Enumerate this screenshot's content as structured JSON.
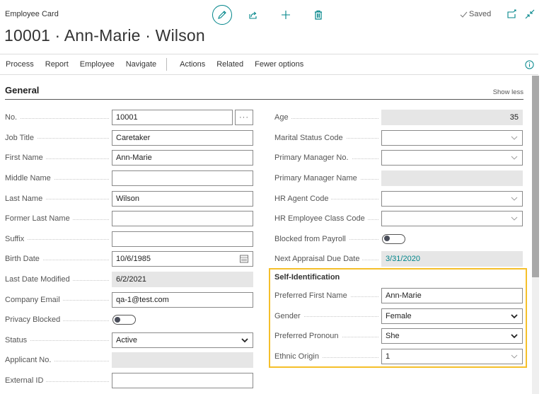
{
  "header": {
    "caption": "Employee Card",
    "title": "10001 · Ann-Marie · Wilson",
    "saved_status": "Saved",
    "icons": [
      "edit-icon",
      "share-icon",
      "add-icon",
      "delete-icon",
      "open-new-window-icon",
      "collapse-icon"
    ]
  },
  "actionbar": {
    "items": [
      "Process",
      "Report",
      "Employee",
      "Navigate"
    ],
    "items2": [
      "Actions",
      "Related",
      "Fewer options"
    ]
  },
  "section": {
    "title": "General",
    "toggle_label": "Show less"
  },
  "left_fields": [
    {
      "label": "No.",
      "value": "10001"
    },
    {
      "label": "Job Title",
      "value": "Caretaker"
    },
    {
      "label": "First Name",
      "value": "Ann-Marie"
    },
    {
      "label": "Middle Name",
      "value": ""
    },
    {
      "label": "Last Name",
      "value": "Wilson"
    },
    {
      "label": "Former Last Name",
      "value": ""
    },
    {
      "label": "Suffix",
      "value": ""
    },
    {
      "label": "Birth Date",
      "value": "10/6/1985"
    },
    {
      "label": "Last Date Modified",
      "value": "6/2/2021"
    },
    {
      "label": "Company Email",
      "value": "qa-1@test.com"
    },
    {
      "label": "Privacy Blocked",
      "value": false
    },
    {
      "label": "Status",
      "value": "Active"
    },
    {
      "label": "Applicant No.",
      "value": ""
    },
    {
      "label": "External ID",
      "value": ""
    }
  ],
  "right_fields": [
    {
      "label": "Age",
      "value": "35"
    },
    {
      "label": "Marital Status Code",
      "value": ""
    },
    {
      "label": "Primary Manager No.",
      "value": ""
    },
    {
      "label": "Primary Manager Name",
      "value": ""
    },
    {
      "label": "HR Agent Code",
      "value": ""
    },
    {
      "label": "HR Employee Class Code",
      "value": ""
    },
    {
      "label": "Blocked from Payroll",
      "value": false
    },
    {
      "label": "Next Appraisal Due Date",
      "value": "3/31/2020"
    }
  ],
  "self_identification": {
    "title": "Self-Identification",
    "fields": [
      {
        "label": "Preferred First Name",
        "value": "Ann-Marie"
      },
      {
        "label": "Gender",
        "value": "Female"
      },
      {
        "label": "Preferred Pronoun",
        "value": "She"
      },
      {
        "label": "Ethnic Origin",
        "value": "1"
      }
    ]
  },
  "colors": {
    "accent": "#00858a",
    "highlight_border": "#f5bf2a",
    "readonly_bg": "#e6e6e6"
  }
}
